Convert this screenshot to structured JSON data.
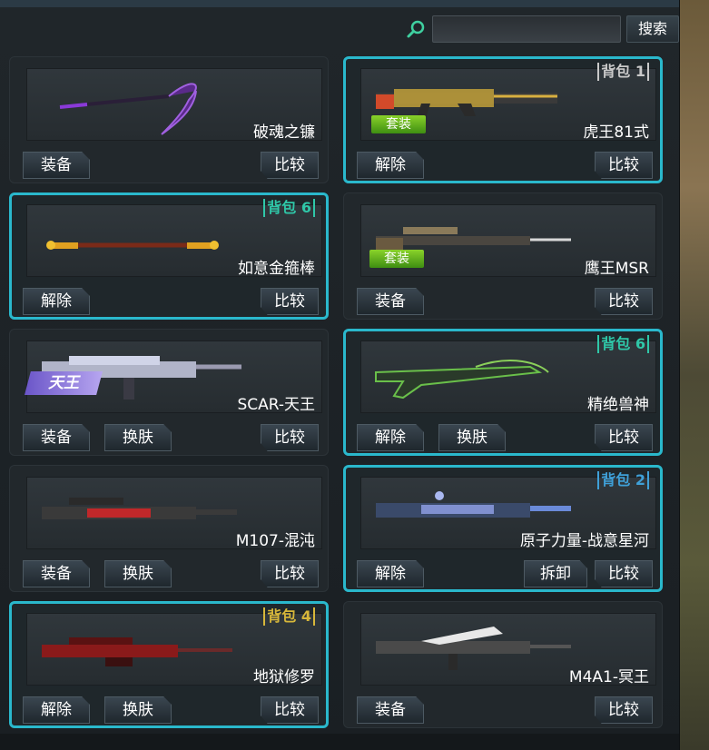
{
  "search": {
    "placeholder": "",
    "value": "",
    "button_label": "搜索",
    "accent": "#2ab8cc"
  },
  "colors": {
    "selected_border": "#2ab8cc",
    "suit_badge": "#6fbe20",
    "tianwang_badge": "#8c7adf"
  },
  "cards": [
    {
      "name": "破魂之镰",
      "selected": false,
      "bag": "",
      "badge": "",
      "buttons": [
        "装备"
      ],
      "compare": "比较",
      "weapon_icon": "scythe-icon"
    },
    {
      "name": "虎王81式",
      "selected": true,
      "bag": "背包 1",
      "bag_color": "gray",
      "badge": "套装",
      "buttons": [
        "解除"
      ],
      "compare": "比较",
      "weapon_icon": "rifle-icon"
    },
    {
      "name": "如意金箍棒",
      "selected": true,
      "bag": "背包 6",
      "bag_color": "green",
      "badge": "",
      "buttons": [
        "解除"
      ],
      "compare": "比较",
      "weapon_icon": "staff-icon"
    },
    {
      "name": "鹰王MSR",
      "selected": false,
      "bag": "",
      "badge": "套装",
      "buttons": [
        "装备"
      ],
      "compare": "比较",
      "weapon_icon": "sniper-icon"
    },
    {
      "name": "SCAR-天王",
      "selected": false,
      "bag": "",
      "badge": "天王",
      "buttons": [
        "装备",
        "换肤"
      ],
      "compare": "比较",
      "weapon_icon": "rifle-icon"
    },
    {
      "name": "精绝兽神",
      "selected": true,
      "bag": "背包 6",
      "bag_color": "green",
      "badge": "",
      "buttons": [
        "解除",
        "换肤"
      ],
      "compare": "比较",
      "weapon_icon": "rifle-icon"
    },
    {
      "name": "M107-混沌",
      "selected": false,
      "bag": "",
      "badge": "",
      "buttons": [
        "装备",
        "换肤"
      ],
      "compare": "比较",
      "weapon_icon": "sniper-icon"
    },
    {
      "name": "原子力量-战意星河",
      "selected": true,
      "bag": "背包 2",
      "bag_color": "blue",
      "badge": "",
      "buttons": [
        "解除"
      ],
      "extra": "拆卸",
      "compare": "比较",
      "weapon_icon": "rifle-icon"
    },
    {
      "name": "地狱修罗",
      "selected": true,
      "bag": "背包 4",
      "bag_color": "gold",
      "badge": "",
      "buttons": [
        "解除",
        "换肤"
      ],
      "compare": "比较",
      "weapon_icon": "sniper-icon"
    },
    {
      "name": "M4A1-冥王",
      "selected": false,
      "bag": "",
      "badge": "",
      "buttons": [
        "装备"
      ],
      "compare": "比较",
      "weapon_icon": "rifle-icon"
    }
  ]
}
